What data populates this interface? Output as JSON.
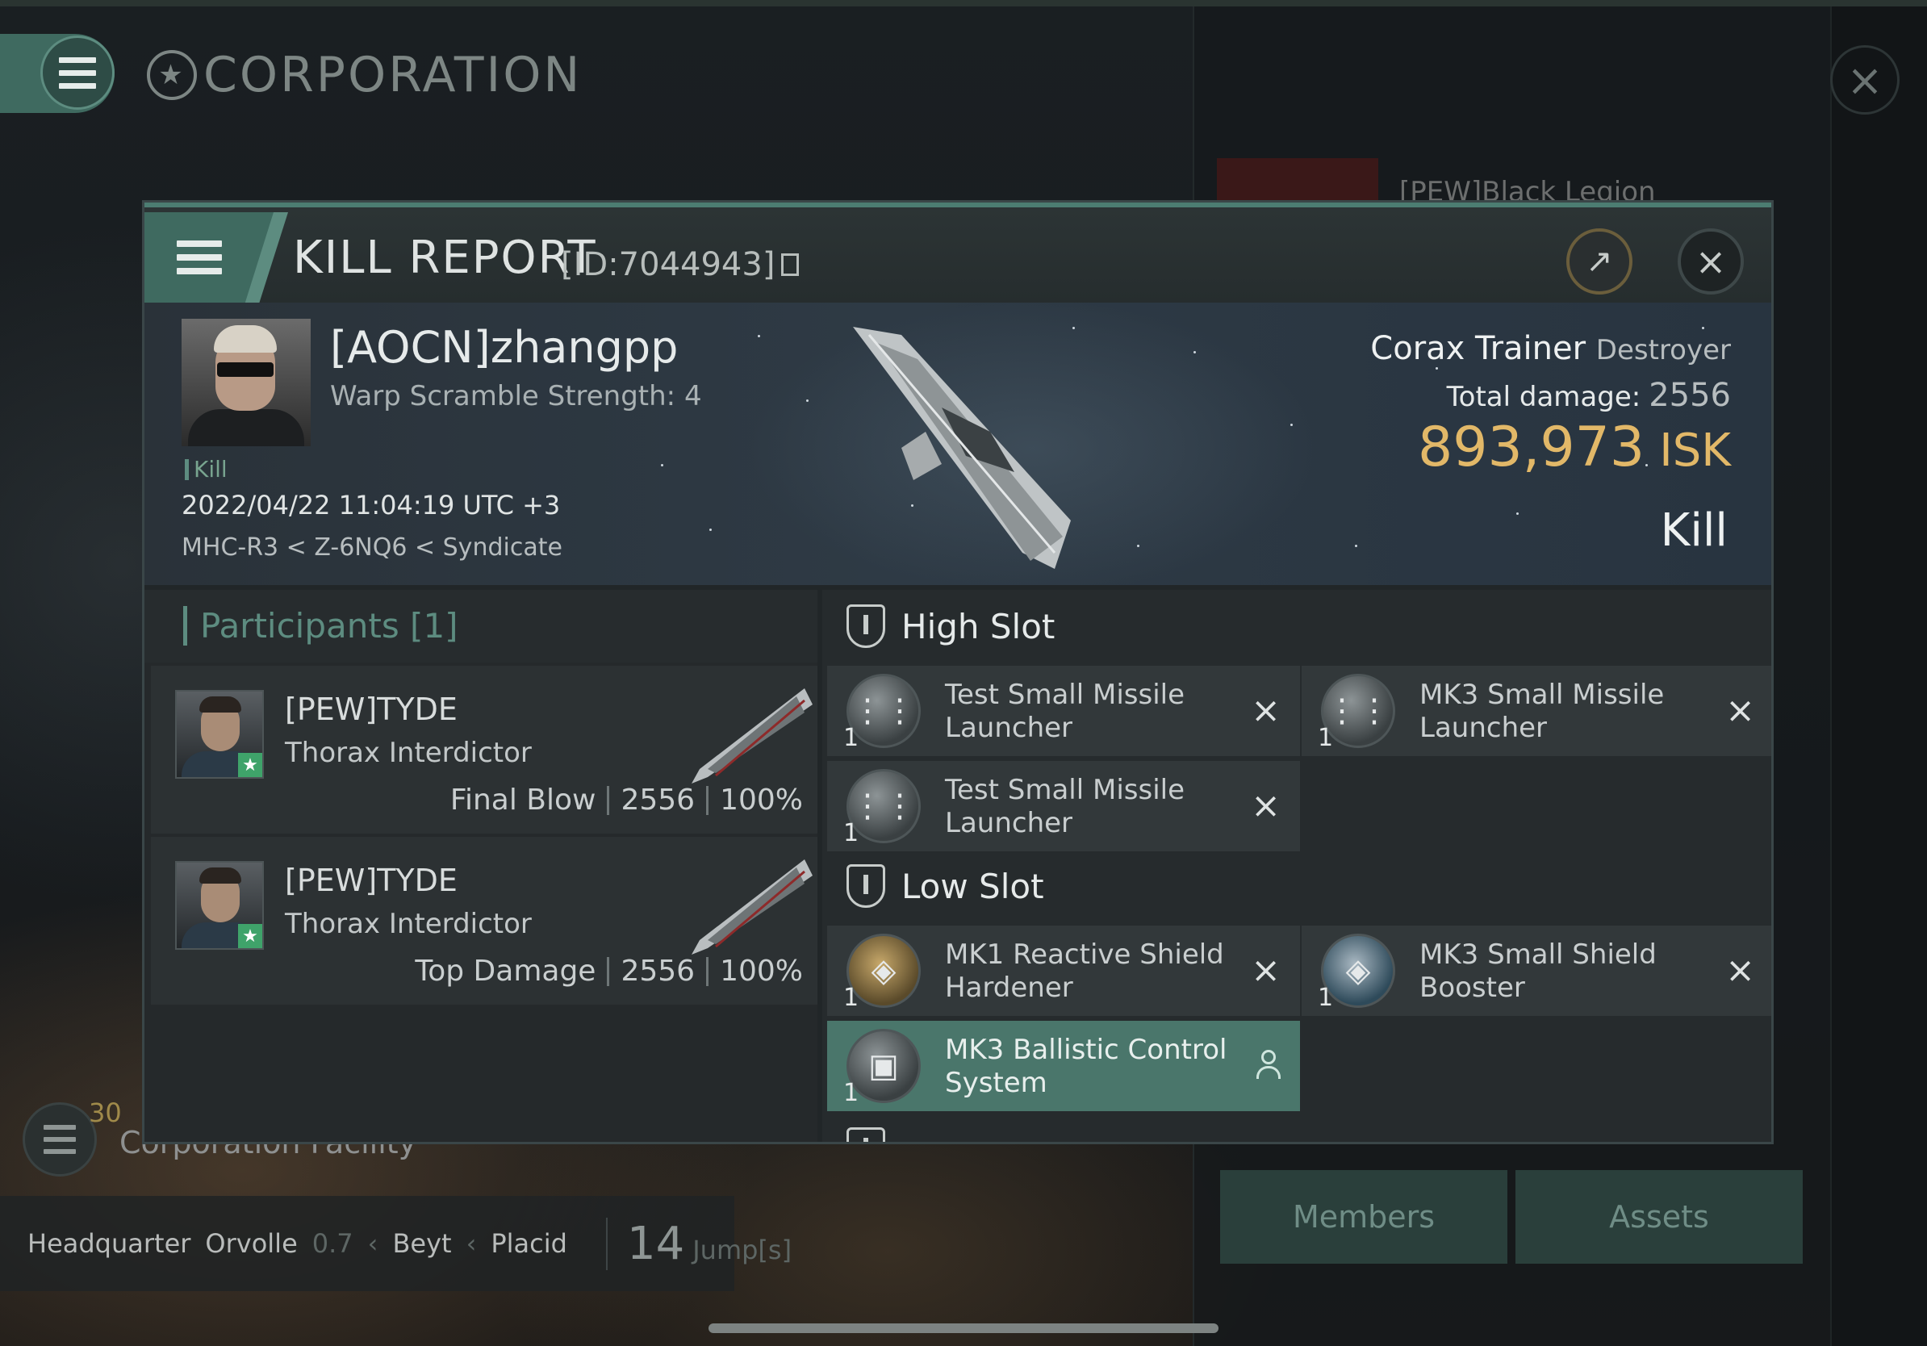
{
  "background": {
    "title": "CORPORATION",
    "corp_name_partial": "[PEW]Black Legion",
    "facility_count": "30",
    "facility_label": "Corporation Facility",
    "hq": {
      "label": "Headquarter",
      "system": "Orvolle",
      "security": "0.7",
      "constellation": "Beyt",
      "region": "Placid",
      "jumps": "14",
      "jumps_label": "Jump[s]"
    },
    "tabs": [
      "Members",
      "Assets"
    ]
  },
  "dialog": {
    "title": "KILL REPORT",
    "report_id": "[ID:7044943]",
    "victim": {
      "name": "[AOCN]zhangpp",
      "warp_scramble": "Warp Scramble Strength: 4",
      "tag": "Kill",
      "timestamp": "2022/04/22 11:04:19 UTC +3",
      "location": "MHC-R3 < Z-6NQ6 < Syndicate"
    },
    "ship": {
      "name": "Corax Trainer",
      "class": "Destroyer",
      "total_damage_label": "Total damage:",
      "total_damage": "2556",
      "isk_value": "893,973",
      "isk_unit": "ISK",
      "result": "Kill"
    },
    "participants": {
      "header": "Participants [1]",
      "rows": [
        {
          "name": "[PEW]TYDE",
          "ship": "Thorax Interdictor",
          "role": "Final Blow",
          "damage": "2556",
          "percent": "100%"
        },
        {
          "name": "[PEW]TYDE",
          "ship": "Thorax Interdictor",
          "role": "Top Damage",
          "damage": "2556",
          "percent": "100%"
        }
      ]
    },
    "fitting": {
      "high_slot_label": "High Slot",
      "low_slot_label": "Low Slot",
      "high_slot": [
        {
          "name": "Test Small Missile Launcher",
          "qty": "1"
        },
        {
          "name": "MK3 Small Missile Launcher",
          "qty": "1"
        },
        {
          "name": "Test Small Missile Launcher",
          "qty": "1"
        }
      ],
      "low_slot": [
        {
          "name": "MK1 Reactive Shield Hardener",
          "qty": "1"
        },
        {
          "name": "MK3 Small Shield Booster",
          "qty": "1"
        },
        {
          "name": "MK3 Ballistic Control System",
          "qty": "1"
        }
      ]
    }
  }
}
